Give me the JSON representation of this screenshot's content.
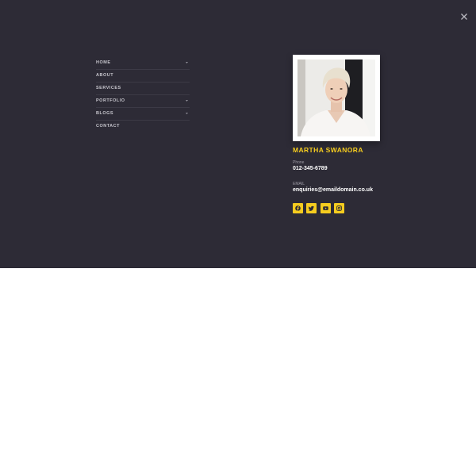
{
  "menu": {
    "items": [
      {
        "label": "HOME",
        "has_submenu": true
      },
      {
        "label": "ABOUT",
        "has_submenu": false
      },
      {
        "label": "SERVICES",
        "has_submenu": false
      },
      {
        "label": "PORTFOLIO",
        "has_submenu": true
      },
      {
        "label": "BLOGS",
        "has_submenu": true
      },
      {
        "label": "CONTACT",
        "has_submenu": false
      }
    ]
  },
  "profile": {
    "name": "MARTHA SWANORA",
    "phone_label": "Phone",
    "phone_value": "012-345-6789",
    "email_label": "EMAIL",
    "email_value": "enquiries@emaildomain.co.uk"
  },
  "socials": [
    {
      "icon": "facebook-icon"
    },
    {
      "icon": "twitter-icon"
    },
    {
      "icon": "youtube-icon"
    },
    {
      "icon": "instagram-icon"
    }
  ],
  "colors": {
    "overlay_bg": "#2d2b36",
    "accent": "#f5cc1f",
    "menu_text": "#c6c5cc",
    "value_text": "#ffffff"
  }
}
